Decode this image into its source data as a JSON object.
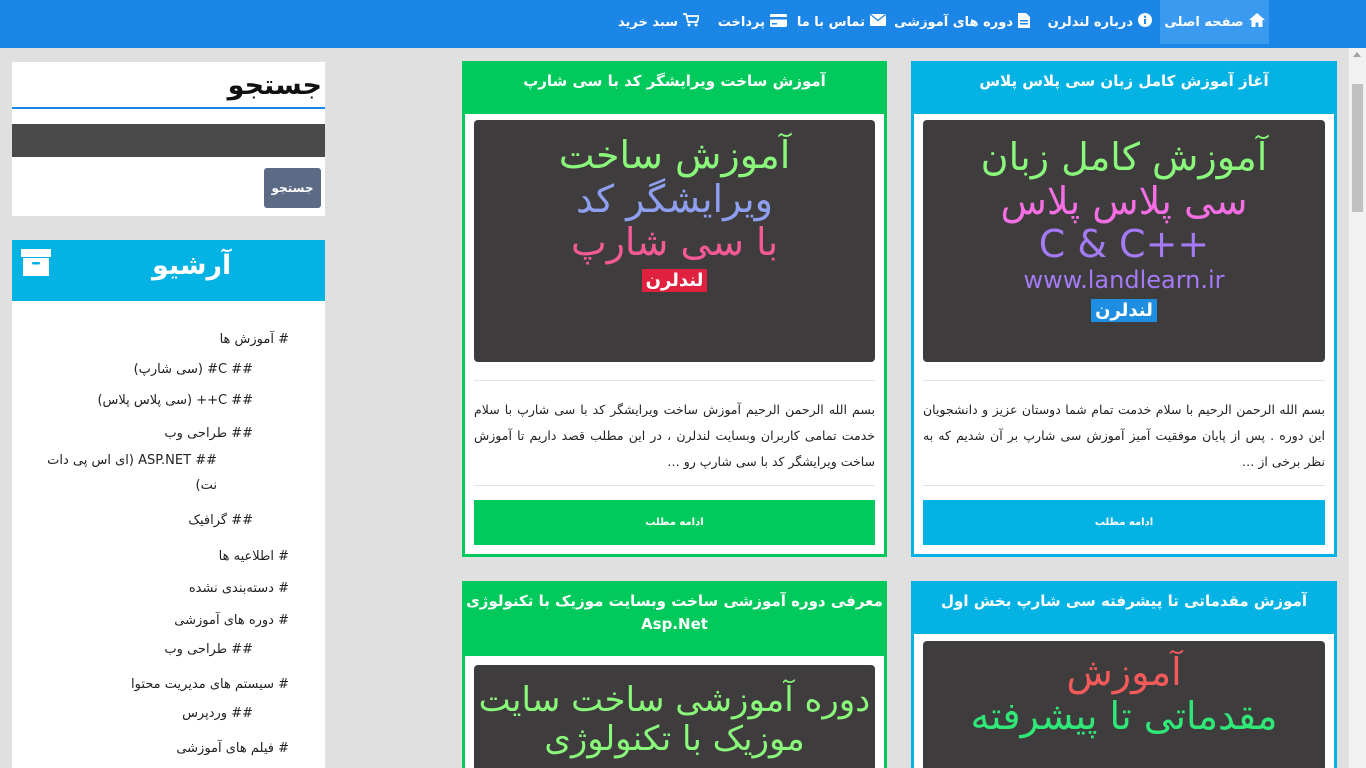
{
  "nav": {
    "home": "صفحه اصلی",
    "about": "درباره لندلرن",
    "courses": "دوره های آموزشی",
    "contact": "تماس با ما",
    "payment": "پرداخت",
    "cart": "سبد خرید"
  },
  "search": {
    "title": "جستجو",
    "button": "جستجو"
  },
  "archive": {
    "title": "آرشیو",
    "items": [
      "# آموزش ها",
      "## C# (سی شارپ)",
      "## C++ (سی پلاس پلاس)",
      "## طراحی وب",
      "## ASP.NET (ای اس پی دات",
      "نت)",
      "## گرافیک",
      "# اطلاعیه ها",
      "# دسته‌بندی نشده",
      "# دوره های آموزشی",
      "## طراحی وب",
      "# سیستم های مدیریت محتوا",
      "## وردپرس",
      "# فیلم های آموزشی"
    ]
  },
  "cards": [
    {
      "title": "آغاز آموزش کامل زبان سی پلاس پلاس",
      "img_lines": [
        "آموزش کامل زبان",
        "سی پلاس پلاس",
        "C & C++",
        "www.landlearn.ir"
      ],
      "logo": "لندلرن",
      "excerpt": "بسم الله الرحمن الرحیم با سلام خدمت تمام شما دوستان عزیز و دانشجویان این دوره . پس از پایان موفقیت آمیز آموزش سی شارپ بر آن شدیم که به نظر برخی از …",
      "button": "ادامه مطلب"
    },
    {
      "title": "آموزش ساخت ویرایشگر کد با سی شارپ",
      "img_lines": [
        "آموزش ساخت",
        "ویرایشگر کد",
        "با سی شارپ"
      ],
      "logo": "لندلرن",
      "excerpt": "بسم الله الرحمن الرحیم آموزش ساخت ویرایشگر کد با سی شارپ با سلام خدمت تمامی کاربران وبسایت لندلرن ، در این مطلب قصد داریم تا آموزش ساخت ویرایشگر کد با سی شارپ رو …",
      "button": "ادامه مطلب"
    },
    {
      "title": "آموزش مقدماتی تا پیشرفته سی شارپ بخش اول",
      "img_lines": [
        "آموزش",
        "مقدماتی تا پیشرفته"
      ]
    },
    {
      "title": "معرفی دوره آموزشی ساخت وبسایت موزیک با تکنولوژی Asp.Net",
      "img_lines": [
        "دوره آموزشی ساخت سایت",
        "موزیک با تکنولوژی"
      ]
    }
  ],
  "colors": {
    "nav": "#1c86e6",
    "blue": "#04b2e4",
    "green": "#02c95c"
  }
}
